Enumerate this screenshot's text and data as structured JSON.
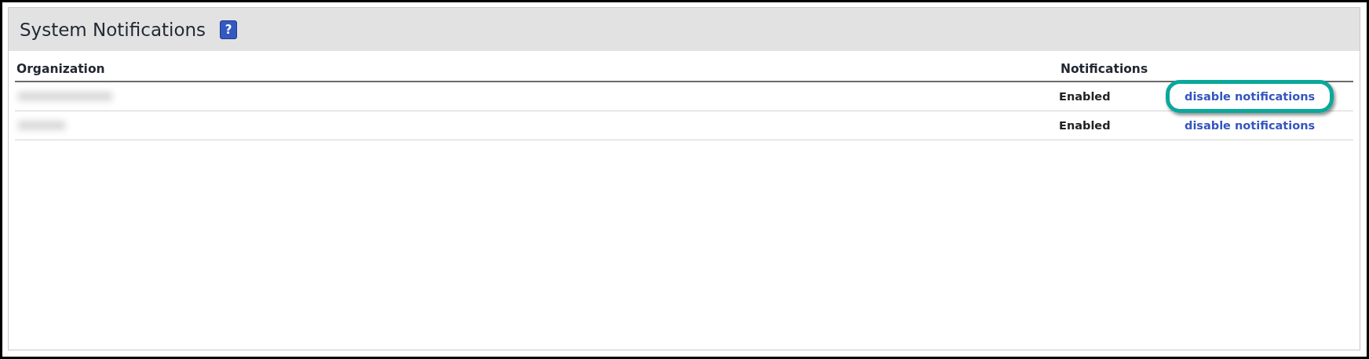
{
  "panel": {
    "title": "System Notifications",
    "help_icon": "?"
  },
  "table": {
    "columns": [
      "Organization",
      "Notifications"
    ],
    "rows": [
      {
        "status": "Enabled",
        "action": "disable notifications",
        "highlighted": true
      },
      {
        "status": "Enabled",
        "action": "disable notifications",
        "highlighted": false
      }
    ]
  }
}
